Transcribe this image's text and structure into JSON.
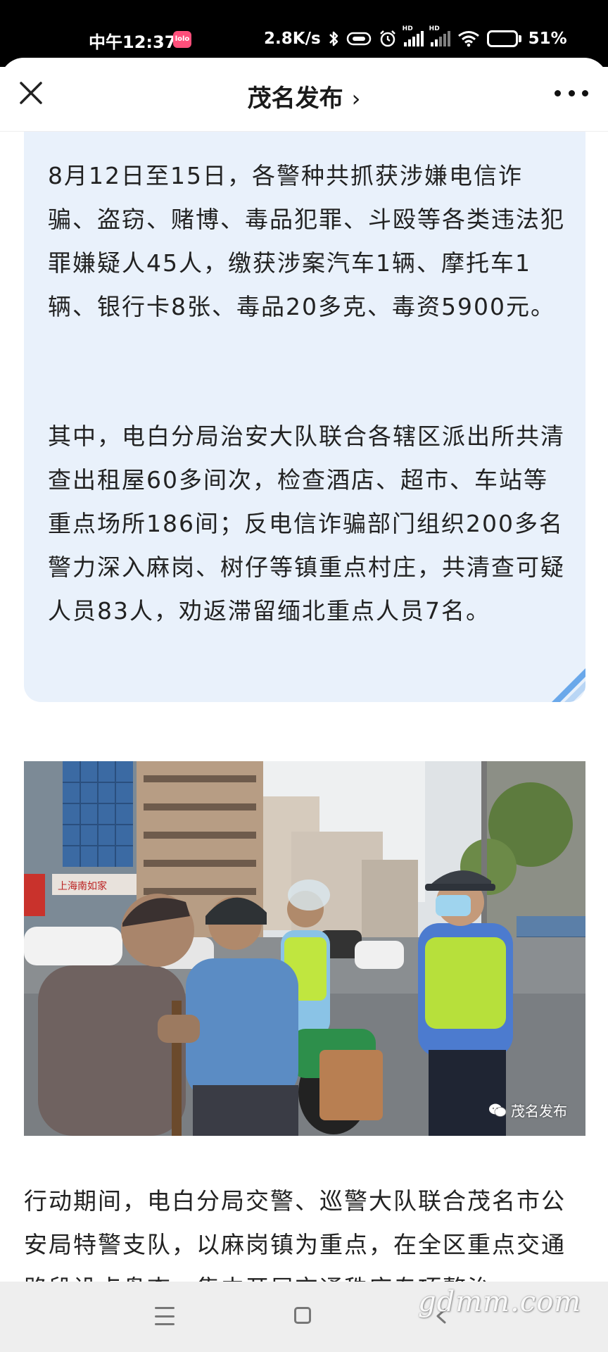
{
  "status_bar": {
    "time": "中午12:37",
    "app_badge": "lolo",
    "net_speed": "2.8K/s",
    "battery": "51%",
    "hd_label": "HD"
  },
  "header": {
    "title": "茂名发布",
    "chevron": "›"
  },
  "article": {
    "quote_paragraphs": [
      "8月12日至15日，各警种共抓获涉嫌电信诈骗、盗窃、赌博、毒品犯罪、斗殴等各类违法犯罪嫌疑人45人，缴获涉案汽车1辆、摩托车1辆、银行卡8张、毒品20多克、毒资5900元。",
      "其中，电白分局治安大队联合各辖区派出所共清查出租屋60多间次，检查酒店、超市、车站等重点场所186间；反电信诈骗部门组织200多名警力深入麻岗、树仔等镇重点村庄，共清查可疑人员83人，劝返滞留缅北重点人员7名。"
    ],
    "photo_watermark": "茂名发布",
    "body_paragraph": "行动期间，电白分局交警、巡警大队联合茂名市公安局特警支队，以麻岗镇为重点，在全区重点交通路段设点盘查，集中开展交通秩序专项整治"
  },
  "site_watermark": "gdmm.com",
  "icons": {
    "close": "close-icon",
    "more": "more-icon",
    "bluetooth": "bluetooth-icon",
    "wifi": "wifi-icon",
    "alarm": "alarm-icon"
  },
  "colors": {
    "quote_bg": "#e9f1fb",
    "quote_corner": "#6aa8ea",
    "status_bar": "#000000",
    "nav_bar": "#eeeeee"
  }
}
